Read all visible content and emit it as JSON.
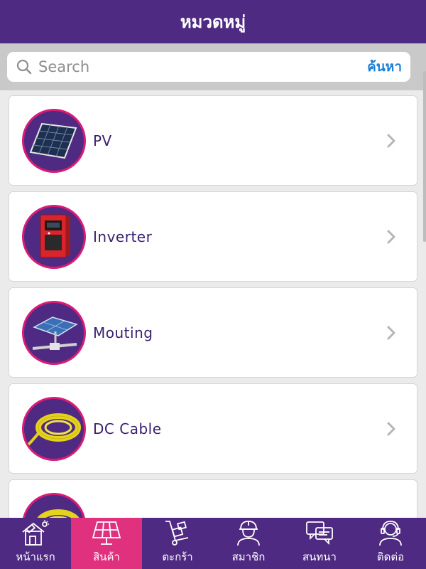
{
  "header": {
    "title": "หมวดหมู่"
  },
  "search": {
    "placeholder": "Search",
    "button_label": "ค้นหา"
  },
  "categories": [
    {
      "label": "PV",
      "icon": "solar-panel-icon"
    },
    {
      "label": "Inverter",
      "icon": "inverter-icon"
    },
    {
      "label": "Mouting",
      "icon": "mounting-icon"
    },
    {
      "label": "DC Cable",
      "icon": "cable-icon"
    },
    {
      "label": "",
      "icon": "cable-icon"
    }
  ],
  "tabs": [
    {
      "label": "หน้าแรก",
      "icon": "home-solar-icon",
      "active": false
    },
    {
      "label": "สินค้า",
      "icon": "solar-panel-icon",
      "active": true
    },
    {
      "label": "ตะกร้า",
      "icon": "hand-truck-icon",
      "active": false
    },
    {
      "label": "สมาชิก",
      "icon": "worker-icon",
      "active": false
    },
    {
      "label": "สนทนา",
      "icon": "chat-icon",
      "active": false
    },
    {
      "label": "ติดต่อ",
      "icon": "support-agent-icon",
      "active": false
    }
  ],
  "colors": {
    "primary": "#4f2a82",
    "accent": "#e0317f",
    "link": "#1b7fd8",
    "text": "#3a1e6e"
  }
}
